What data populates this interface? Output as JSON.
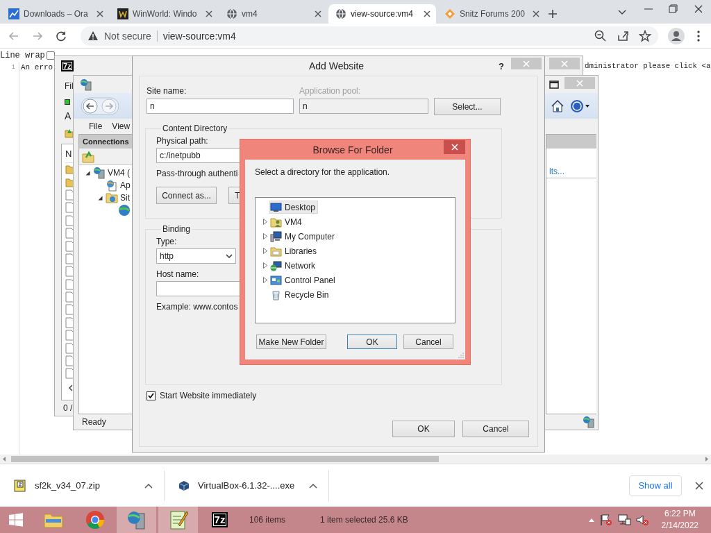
{
  "browser": {
    "tabs": [
      {
        "label": "Downloads – Ora",
        "kind": "chart",
        "selected": false
      },
      {
        "label": "WinWorld: Windo",
        "kind": "square",
        "selected": false
      },
      {
        "label": "vm4",
        "kind": "globe",
        "selected": false
      },
      {
        "label": "view-source:vm4",
        "kind": "globe",
        "selected": true
      },
      {
        "label": "Snitz Forums 200",
        "kind": "diamond",
        "selected": false
      }
    ],
    "address": {
      "security": "Not secure",
      "url": "view-source:vm4"
    }
  },
  "page": {
    "line_wrap": {
      "label": "Line wrap",
      "checked": false
    },
    "line_number": "1",
    "line_start": "An erro",
    "line_end": "dministrator please click <a"
  },
  "sevenzip": {
    "logo_text": "7z",
    "menu_partial": "Fil",
    "toolbar_partial": "A",
    "column_partial": "N",
    "status_partial": "0 /",
    "list_rows": [
      {
        "kind": "folder"
      },
      {
        "kind": "folder"
      },
      {
        "kind": "file"
      },
      {
        "kind": "file"
      },
      {
        "kind": "file"
      },
      {
        "kind": "file"
      },
      {
        "kind": "file"
      },
      {
        "kind": "file"
      },
      {
        "kind": "file"
      },
      {
        "kind": "file"
      },
      {
        "kind": "file"
      },
      {
        "kind": "file"
      },
      {
        "kind": "file"
      },
      {
        "kind": "file"
      },
      {
        "kind": "file"
      },
      {
        "kind": "file"
      },
      {
        "kind": "file"
      }
    ]
  },
  "iis": {
    "menu": [
      "File",
      "View"
    ],
    "connections_title": "Connections",
    "tree": [
      {
        "label": "VM4 (",
        "kind": "server",
        "expanded": true,
        "children": [
          {
            "label": "Ap",
            "kind": "pools"
          },
          {
            "label": "Sit",
            "kind": "sites",
            "expanded": true,
            "children": [
              {
                "kind": "site"
              }
            ]
          }
        ]
      }
    ],
    "link_partial": "lts...",
    "status": "Ready"
  },
  "add_website": {
    "title": "Add Website",
    "help": "?",
    "site_name": {
      "label": "Site name:",
      "value": "n"
    },
    "app_pool": {
      "label": "Application pool:",
      "value": "n",
      "disabled": true
    },
    "select_button": "Select...",
    "content_directory": {
      "legend": "Content Directory",
      "path_label": "Physical path:",
      "path_value": "c:/inetpubb",
      "auth_partial": "Pass-through authenti",
      "connect_button": "Connect as...",
      "test_partial": "T"
    },
    "binding": {
      "legend": "Binding",
      "type_label": "Type:",
      "type_value": "http",
      "host_label": "Host name:",
      "example_partial": "Example: www.contos"
    },
    "start_immediately": {
      "label": "Start Website immediately",
      "checked": true
    },
    "buttons": [
      "OK",
      "Cancel"
    ]
  },
  "browse": {
    "title": "Browse For Folder",
    "prompt": "Select a directory for the application.",
    "items": [
      {
        "label": "Desktop",
        "kind": "desktop",
        "expandable": false,
        "selected": true
      },
      {
        "label": "VM4",
        "kind": "user",
        "expandable": true,
        "selected": false
      },
      {
        "label": "My Computer",
        "kind": "computer",
        "expandable": true,
        "selected": false
      },
      {
        "label": "Libraries",
        "kind": "libraries",
        "expandable": true,
        "selected": false
      },
      {
        "label": "Network",
        "kind": "network",
        "expandable": true,
        "selected": false
      },
      {
        "label": "Control Panel",
        "kind": "control",
        "expandable": true,
        "selected": false
      },
      {
        "label": "Recycle Bin",
        "kind": "recycle",
        "expandable": false,
        "selected": false
      }
    ],
    "buttons": [
      "Make New Folder",
      "OK",
      "Cancel"
    ]
  },
  "downloads": {
    "items": [
      {
        "name": "sf2k_v34_07.zip",
        "kind": "zip"
      },
      {
        "name": "VirtualBox-6.1.32-....exe",
        "kind": "installer"
      }
    ],
    "show_all": "Show all"
  },
  "taskbar": {
    "apps": [
      {
        "kind": "folder",
        "active": false
      },
      {
        "kind": "chrome",
        "active": false
      },
      {
        "kind": "server",
        "active": true
      },
      {
        "kind": "notepad",
        "active": true
      },
      {
        "kind": "sevenzip",
        "active": false,
        "logo_text": "7z"
      }
    ],
    "behind": [
      "106 items",
      "1 item selected  25.6 KB"
    ],
    "time": "6:22 PM",
    "date": "2/14/2022"
  }
}
